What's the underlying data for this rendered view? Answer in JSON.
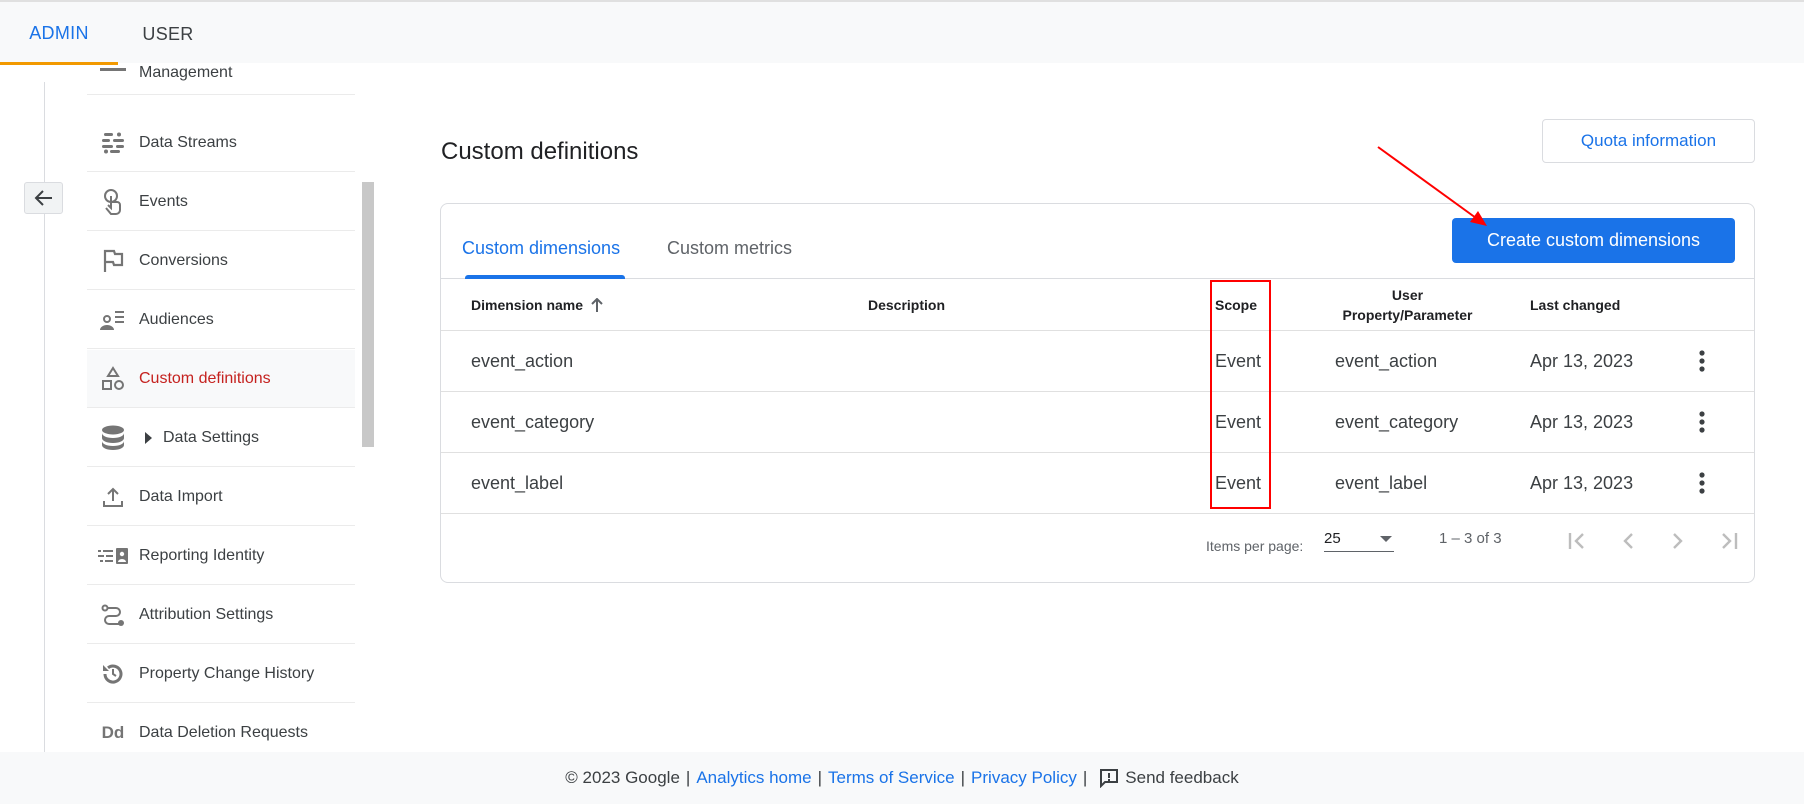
{
  "topbar": {
    "tabs": [
      {
        "label": "ADMIN",
        "active": true
      },
      {
        "label": "USER",
        "active": false
      }
    ],
    "accent_color": "#f29900"
  },
  "sidebar": {
    "back_icon": "arrow-left-icon",
    "items": [
      {
        "label": "Management",
        "icon": "partial-icon",
        "active": false
      },
      {
        "label": "Data Streams",
        "icon": "data-streams-icon",
        "active": false
      },
      {
        "label": "Events",
        "icon": "touch-icon",
        "active": false
      },
      {
        "label": "Conversions",
        "icon": "flag-icon",
        "active": false
      },
      {
        "label": "Audiences",
        "icon": "audience-icon",
        "active": false
      },
      {
        "label": "Custom definitions",
        "icon": "shapes-icon",
        "active": true
      },
      {
        "label": "Data Settings",
        "icon": "database-icon",
        "active": false,
        "expandable": true
      },
      {
        "label": "Data Import",
        "icon": "upload-icon",
        "active": false
      },
      {
        "label": "Reporting Identity",
        "icon": "reporting-identity-icon",
        "active": false
      },
      {
        "label": "Attribution Settings",
        "icon": "attribution-icon",
        "active": false
      },
      {
        "label": "Property Change History",
        "icon": "history-icon",
        "active": false
      },
      {
        "label": "Data Deletion Requests",
        "icon": "dd-icon",
        "active": false
      }
    ],
    "dd_glyph": "Dd",
    "active_color": "#c5221f"
  },
  "main": {
    "title": "Custom definitions",
    "quota_button": "Quota information",
    "tabs": [
      {
        "label": "Custom dimensions",
        "active": true
      },
      {
        "label": "Custom metrics",
        "active": false
      }
    ],
    "create_button": "Create custom dimensions",
    "primary_color": "#1a73e8",
    "table": {
      "columns": [
        "Dimension name",
        "Description",
        "Scope",
        "User Property/Parameter",
        "Last changed"
      ],
      "column_user_line1": "User",
      "column_user_line2": "Property/Parameter",
      "sort_icon": "arrow-up-icon",
      "rows": [
        {
          "name": "event_action",
          "description": "",
          "scope": "Event",
          "parameter": "event_action",
          "last_changed": "Apr 13, 2023"
        },
        {
          "name": "event_category",
          "description": "",
          "scope": "Event",
          "parameter": "event_category",
          "last_changed": "Apr 13, 2023"
        },
        {
          "name": "event_label",
          "description": "",
          "scope": "Event",
          "parameter": "event_label",
          "last_changed": "Apr 13, 2023"
        }
      ]
    },
    "pagination": {
      "items_per_page_label": "Items per page:",
      "items_per_page": "25",
      "range": "1 – 3 of 3"
    }
  },
  "annotations": {
    "highlight_color": "#ff0000"
  },
  "footer": {
    "copyright": "© 2023 Google",
    "links": [
      "Analytics home",
      "Terms of Service",
      "Privacy Policy"
    ],
    "separator": "|",
    "feedback": "Send feedback"
  }
}
